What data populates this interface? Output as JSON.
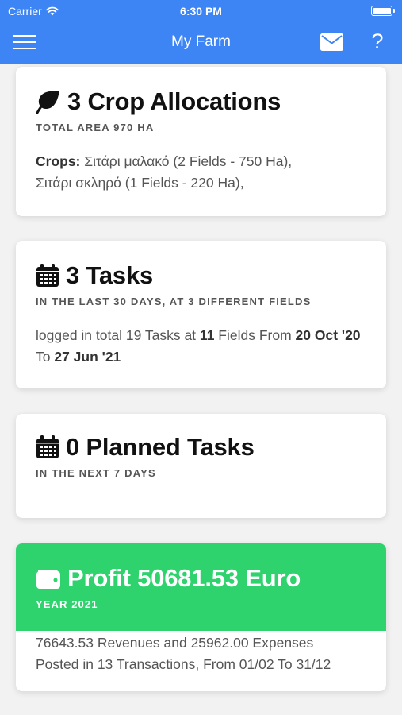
{
  "status_bar": {
    "carrier": "Carrier",
    "time": "6:30 PM"
  },
  "navbar": {
    "title": "My Farm",
    "help_label": "?"
  },
  "crops_card": {
    "title": "3 Crop Allocations",
    "subtitle": "TOTAL AREA 970 HA",
    "crops_label": "Crops:",
    "crops_text": "Σιτάρι μαλακό (2 Fields - 750 Ha),",
    "crops_text_2": "Σιτάρι σκληρό (1 Fields - 220 Ha),"
  },
  "tasks_card": {
    "title": "3 Tasks",
    "subtitle": "IN THE LAST 30 DAYS, AT 3 DIFFERENT FIELDS",
    "body_prefix": "logged in total 19 Tasks at",
    "fields_count": "11",
    "body_middle": "Fields From",
    "date_from": "20 Oct '20",
    "body_to": "To",
    "date_to": "27 Jun '21"
  },
  "planned_card": {
    "title": "0 Planned Tasks",
    "subtitle": "IN THE NEXT 7 DAYS"
  },
  "profit_card": {
    "title": "Profit 50681.53 Euro",
    "subtitle": "YEAR 2021",
    "body_line_1": "76643.53 Revenues and 25962.00 Expenses",
    "body_line_2": "Posted in 13 Transactions, From 01/02 To 31/12",
    "accent_color": "#2ed36e"
  },
  "theme": {
    "header_color": "#3d84f5"
  },
  "icons": {
    "wifi": "wifi-icon",
    "battery": "battery-icon",
    "menu": "hamburger-menu-icon",
    "mail": "mail-icon",
    "leaf": "leaf-icon",
    "calendar": "calendar-icon",
    "wallet": "wallet-icon"
  }
}
